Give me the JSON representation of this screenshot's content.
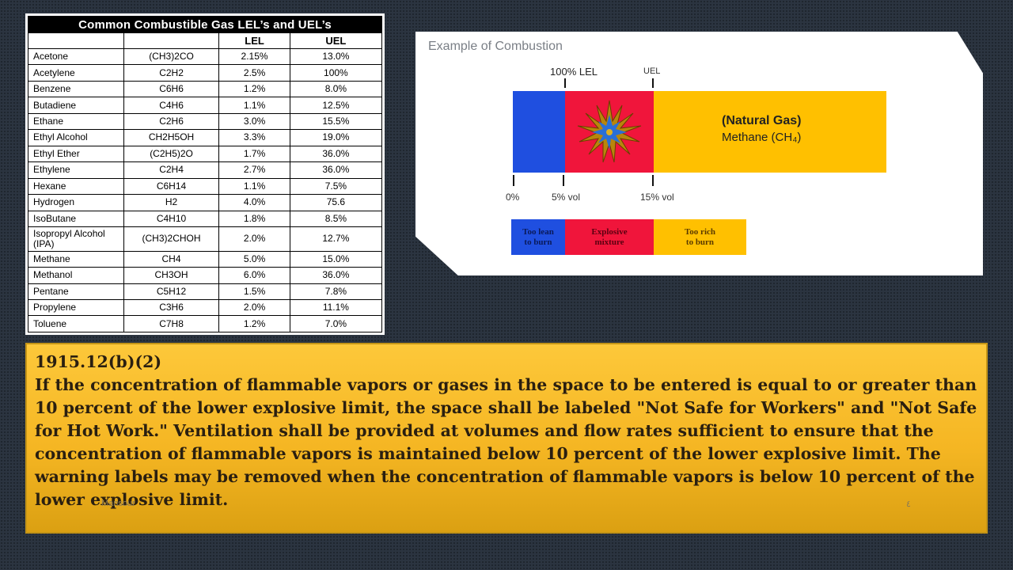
{
  "table": {
    "title": "Common Combustible Gas LEL’s and UEL’s",
    "headers": [
      "",
      "",
      "LEL",
      "UEL"
    ],
    "rows": [
      [
        "Acetone",
        "(CH3)2CO",
        "2.15%",
        "13.0%"
      ],
      [
        "Acetylene",
        "C2H2",
        "2.5%",
        "100%"
      ],
      [
        "Benzene",
        "C6H6",
        "1.2%",
        "8.0%"
      ],
      [
        "Butadiene",
        "C4H6",
        "1.1%",
        "12.5%"
      ],
      [
        "Ethane",
        "C2H6",
        "3.0%",
        "15.5%"
      ],
      [
        "Ethyl Alcohol",
        "CH2H5OH",
        "3.3%",
        "19.0%"
      ],
      [
        "Ethyl Ether",
        "(C2H5)2O",
        "1.7%",
        "36.0%"
      ],
      [
        "Ethylene",
        "C2H4",
        "2.7%",
        "36.0%"
      ],
      [
        "Hexane",
        "C6H14",
        "1.1%",
        "7.5%"
      ],
      [
        "Hydrogen",
        "H2",
        "4.0%",
        "75.6"
      ],
      [
        "IsoButane",
        "C4H10",
        "1.8%",
        "8.5%"
      ],
      [
        "Isopropyl Alcohol (IPA)",
        "(CH3)2CHOH",
        "2.0%",
        "12.7%"
      ],
      [
        "Methane",
        "CH4",
        "5.0%",
        "15.0%"
      ],
      [
        "Methanol",
        "CH3OH",
        "6.0%",
        "36.0%"
      ],
      [
        "Pentane",
        "C5H12",
        "1.5%",
        "7.8%"
      ],
      [
        "Propylene",
        "C3H6",
        "2.0%",
        "11.1%"
      ],
      [
        "Toluene",
        "C7H8",
        "1.2%",
        "7.0%"
      ]
    ]
  },
  "combustion": {
    "title": "Example of Combustion",
    "lel_label": "100% LEL",
    "uel_label": "UEL",
    "gas_name": "(Natural Gas)",
    "gas_formula": "Methane (CH₄)",
    "scale": [
      "0%",
      "5% vol",
      "15% vol"
    ],
    "legend": [
      "Too lean\nto burn",
      "Explosive\nmixture",
      "Too rich\nto burn"
    ],
    "colors": {
      "lean": "#1f4fe0",
      "explosive": "#f0153b",
      "rich": "#ffc000"
    }
  },
  "regulation": {
    "code": "1915.12(b)(2)",
    "text": "If the concentration of flammable vapors or gases in the space to be entered is equal to or greater than 10 percent of the lower explosive limit, the space shall be labeled \"Not Safe for Workers\" and \"Not Safe for Hot Work.\" Ventilation shall be provided at volumes and flow rates sufficient to ensure that the concentration of flammable vapors is maintained below 10 percent of the lower explosive limit. The warning labels may be removed when the concentration of flammable vapors is below 10 percent of the lower explosive limit."
  },
  "footer": {
    "author": "Mansour",
    "page": "٤"
  }
}
